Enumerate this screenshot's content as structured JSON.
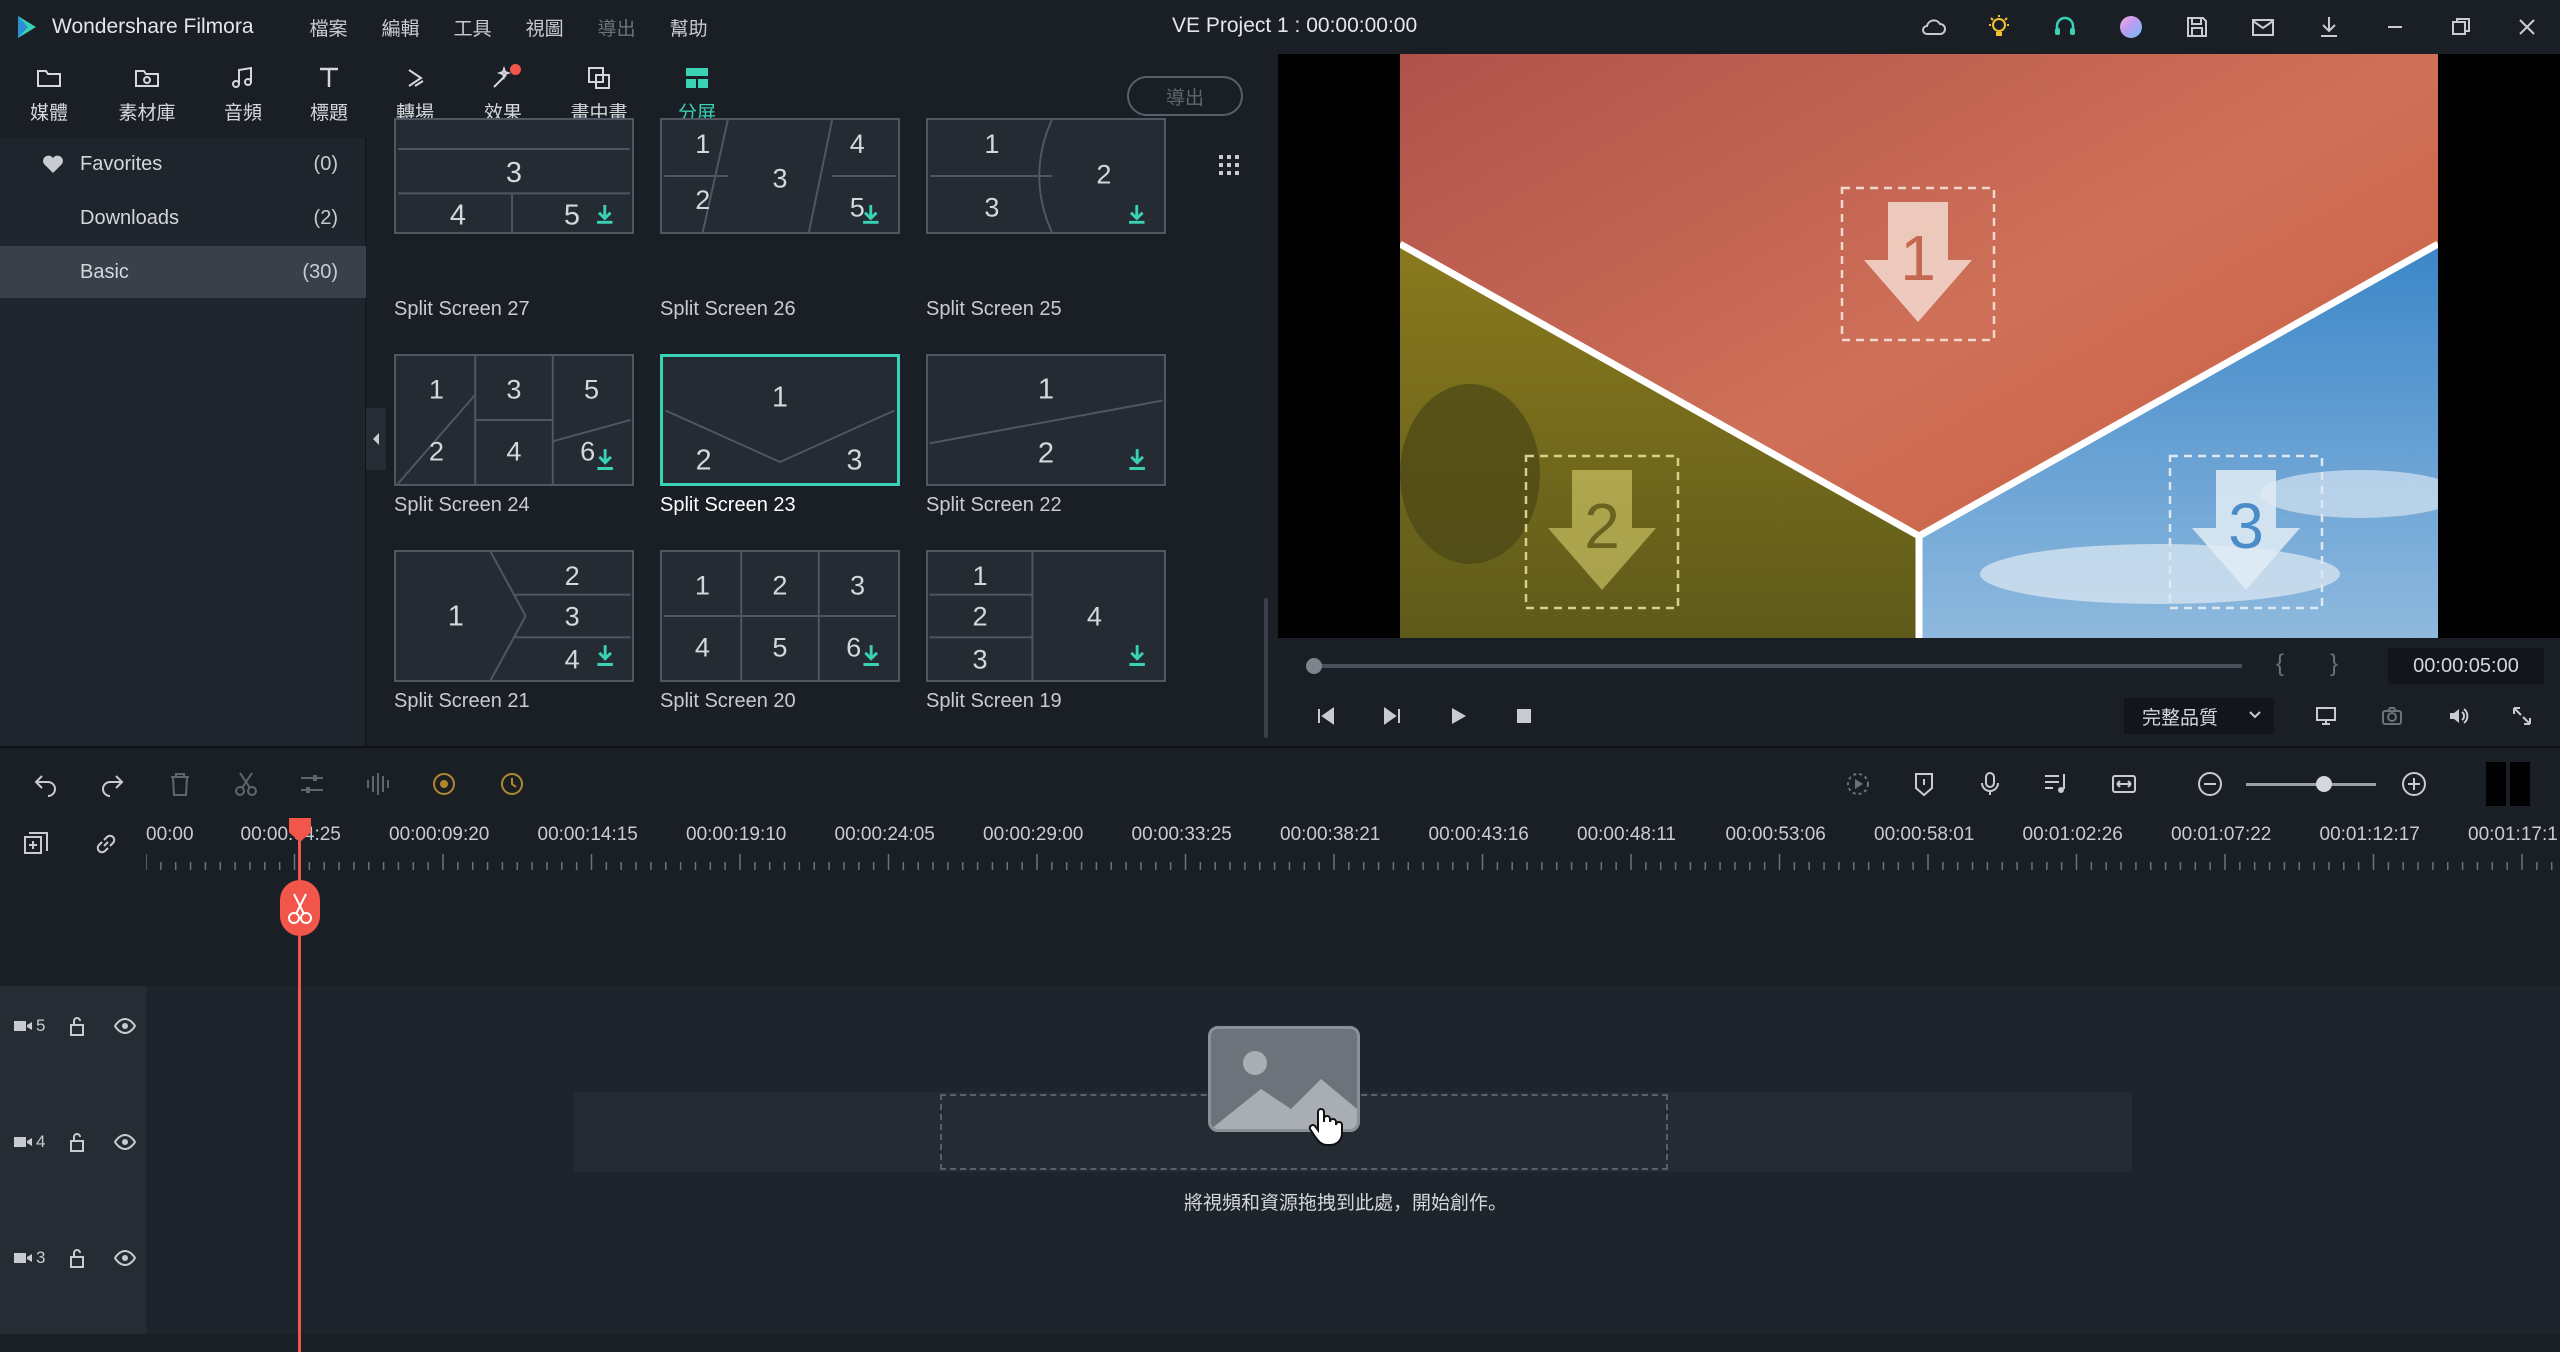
{
  "app": {
    "name": "Wondershare Filmora",
    "project_title": "VE Project 1 : 00:00:00:00",
    "menu": [
      "檔案",
      "編輯",
      "工具",
      "視圖",
      "導出",
      "幫助"
    ]
  },
  "tabs": [
    {
      "label": "媒體",
      "icon": "media-folder-icon"
    },
    {
      "label": "素材庫",
      "icon": "stock-media-icon"
    },
    {
      "label": "音頻",
      "icon": "audio-note-icon"
    },
    {
      "label": "標題",
      "icon": "title-text-icon"
    },
    {
      "label": "轉場",
      "icon": "transition-icon"
    },
    {
      "label": "效果",
      "icon": "effects-icon"
    },
    {
      "label": "畫中畫",
      "icon": "pip-icon"
    },
    {
      "label": "分屏",
      "icon": "split-screen-icon",
      "active": true
    }
  ],
  "export_label": "導出",
  "left_panel": [
    {
      "name": "Favorites",
      "count": "(0)"
    },
    {
      "name": "Downloads",
      "count": "(2)"
    },
    {
      "name": "Basic",
      "count": "(30)",
      "selected": true
    }
  ],
  "gallery": [
    {
      "label": "Split Screen 27"
    },
    {
      "label": "Split Screen 26"
    },
    {
      "label": "Split Screen 25"
    },
    {
      "label": "Split Screen 24"
    },
    {
      "label": "Split Screen 23",
      "selected": true
    },
    {
      "label": "Split Screen 22"
    },
    {
      "label": "Split Screen 21"
    },
    {
      "label": "Split Screen 20"
    },
    {
      "label": "Split Screen 19"
    }
  ],
  "thumb_text": {
    "t27": {
      "a": "3",
      "b": "4",
      "c": "5"
    },
    "t26": {
      "a": "1",
      "b": "2",
      "c": "3",
      "d": "4",
      "e": "5"
    },
    "t25": {
      "a": "1",
      "b": "2",
      "c": "3"
    },
    "t24": {
      "a": "1",
      "b": "3",
      "c": "5",
      "d": "2",
      "e": "4",
      "f": "6"
    },
    "t23": {
      "a": "1",
      "b": "2",
      "c": "3"
    },
    "t22": {
      "a": "1",
      "b": "2"
    },
    "t21": {
      "a": "1",
      "b": "2",
      "c": "3",
      "d": "4"
    },
    "t20": {
      "a": "1",
      "b": "2",
      "c": "3",
      "d": "4",
      "e": "5",
      "f": "6"
    },
    "t19": {
      "a": "1",
      "b": "2",
      "c": "3",
      "d": "4"
    }
  },
  "preview": {
    "zones": [
      "1",
      "2",
      "3"
    ],
    "timecode": "00:00:05:00",
    "mark_in": "{",
    "mark_out": "}",
    "quality": "完整品質",
    "progress": 0
  },
  "timeline": {
    "ruler": [
      "00:00",
      "00:00:04:25",
      "00:00:09:20",
      "00:00:14:15",
      "00:00:19:10",
      "00:00:24:05",
      "00:00:29:00",
      "00:00:33:25",
      "00:00:38:21",
      "00:00:43:16",
      "00:00:48:11",
      "00:00:53:06",
      "00:00:58:01",
      "00:01:02:26",
      "00:01:07:22",
      "00:01:12:17",
      "00:01:17:1"
    ],
    "tracks": [
      "5",
      "4",
      "3"
    ],
    "drop_hint": "將視頻和資源拖拽到此處，開始創作。"
  },
  "colors": {
    "accent": "#39d2b4",
    "playhead": "#f2554a",
    "bg": "#1a1f26"
  }
}
